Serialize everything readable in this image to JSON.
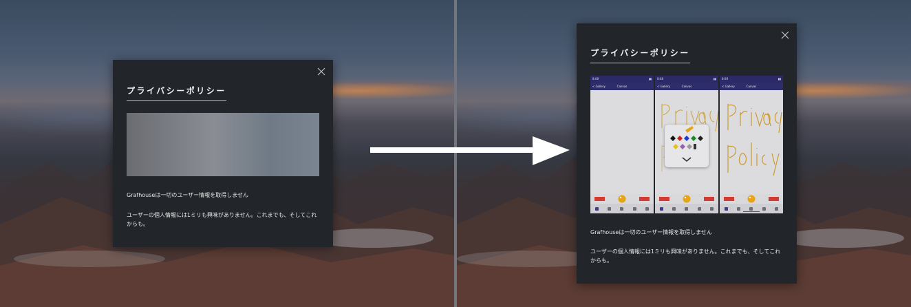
{
  "colors": {
    "modal_bg": "#222529",
    "text": "#e6e6e8",
    "accent_red": "#d23a32",
    "phone_header": "#2b2a66",
    "arrow": "#ffffff"
  },
  "before_modal": {
    "title": "プライバシーポリシー",
    "close_icon": "close-icon",
    "text1": "Grafhouseは一切のユーザー情報を取得しません",
    "text2": "ユーザーの個人情報には1ミリも興味がありません。これまでも、そしてこれからも。"
  },
  "after_modal": {
    "title": "プライバシーポリシー",
    "close_icon": "close-icon",
    "text1": "Grafhouseは一切のユーザー情報を取得しません",
    "text2": "ユーザーの個人情報には1ミリも興味がありません。これまでも、そしてこれからも。",
    "screens": [
      {
        "time": "8:08",
        "back": "< Gallery",
        "title": "Canvas"
      },
      {
        "time": "8:08",
        "back": "< Gallery",
        "title": "Canvas"
      },
      {
        "time": "8:08",
        "back": "< Gallery",
        "title": "Canvas"
      }
    ]
  },
  "arrow_icon": "right-arrow-icon"
}
